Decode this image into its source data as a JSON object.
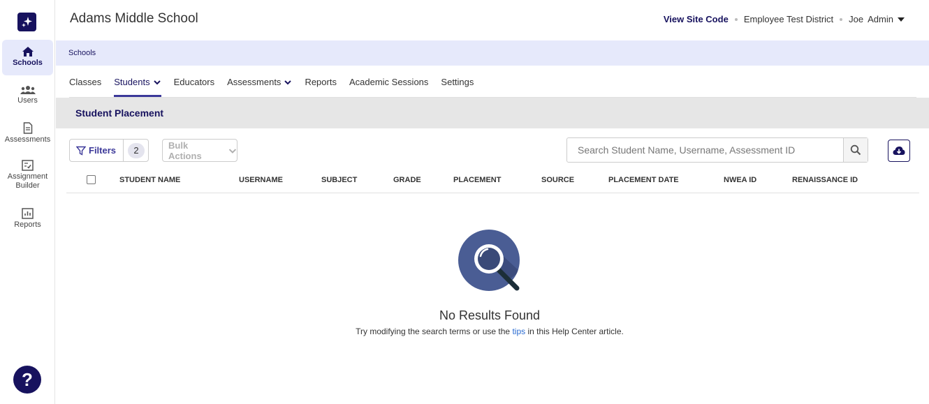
{
  "sidebar": {
    "items": [
      {
        "label": "Schools",
        "icon": "home-icon",
        "active": true
      },
      {
        "label": "Users",
        "icon": "users-icon"
      },
      {
        "label": "Assessments",
        "icon": "document-icon"
      },
      {
        "label": "Assignment Builder",
        "icon": "checklist-icon"
      },
      {
        "label": "Reports",
        "icon": "bar-chart-icon"
      }
    ],
    "help_label": "?"
  },
  "header": {
    "school": "Adams Middle School",
    "site_code": "View Site Code",
    "district": "Employee Test District",
    "user_first": "Joe",
    "user_last": "Admin"
  },
  "breadcrumb": {
    "label": "Schools"
  },
  "tabs": [
    {
      "label": "Classes"
    },
    {
      "label": "Students",
      "active": true,
      "dropdown": true
    },
    {
      "label": "Educators"
    },
    {
      "label": "Assessments",
      "dropdown": true
    },
    {
      "label": "Reports"
    },
    {
      "label": "Academic Sessions"
    },
    {
      "label": "Settings"
    }
  ],
  "section": {
    "title": "Student Placement"
  },
  "toolbar": {
    "filters_label": "Filters",
    "filters_count": "2",
    "bulk_actions": "Bulk Actions",
    "search_placeholder": "Search Student Name, Username, Assessment ID"
  },
  "table": {
    "columns": [
      "STUDENT NAME",
      "USERNAME",
      "SUBJECT",
      "GRADE",
      "PLACEMENT",
      "SOURCE",
      "PLACEMENT DATE",
      "NWEA ID",
      "RENAISSANCE ID"
    ]
  },
  "empty": {
    "title": "No Results Found",
    "text_before": "Try modifying the search terms or use the ",
    "link": "tips",
    "text_after": " in this Help Center article."
  },
  "colors": {
    "brand": "#17125e",
    "accent": "#3b3899",
    "highlight": "#e6e9fb"
  }
}
